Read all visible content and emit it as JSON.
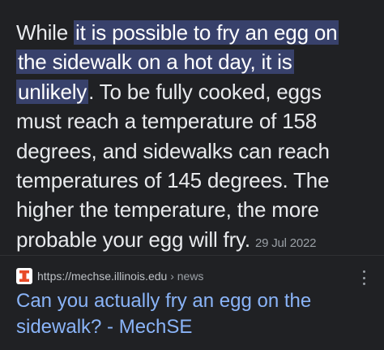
{
  "snippet": {
    "lead": "While ",
    "highlight_1": "it is possible to fry an egg on",
    "highlight_2": "the sidewalk on a hot day, it is",
    "highlight_3": "unlikely",
    "line3_rest": ". To be fully cooked, eggs",
    "line4": "must reach a temperature of 158",
    "line5": "degrees, and sidewalks can reach",
    "line6": "temperatures of 145 degrees. The",
    "line7": "higher the temperature, the more",
    "line8": "probable your egg will fry.",
    "date": "29 Jul 2022"
  },
  "source": {
    "favicon_letter": "I",
    "favicon_color": "#e84a27",
    "url": "https://mechse.illinois.edu",
    "breadcrumb": " › news"
  },
  "result": {
    "title_line1": "Can you actually fry an egg on the",
    "title_line2": "sidewalk? - MechSE"
  },
  "colors": {
    "background": "#202124",
    "highlight": "#38416b",
    "link": "#8ab4f8"
  }
}
